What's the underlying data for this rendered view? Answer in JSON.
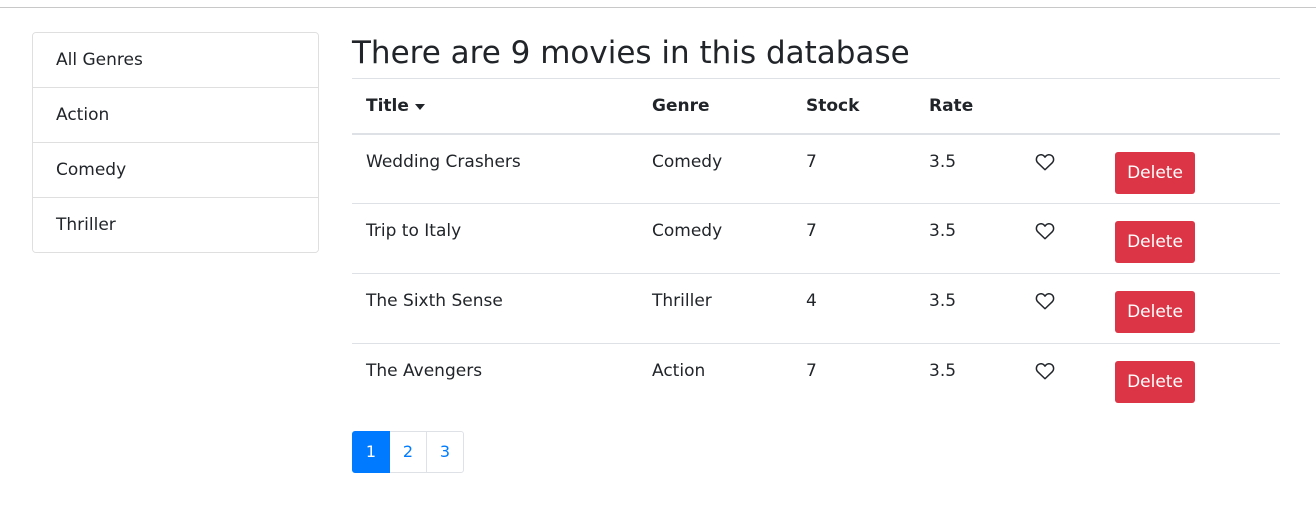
{
  "sidebar": {
    "items": [
      {
        "label": "All Genres"
      },
      {
        "label": "Action"
      },
      {
        "label": "Comedy"
      },
      {
        "label": "Thriller"
      }
    ]
  },
  "main": {
    "title": "There are 9 movies in this database",
    "table": {
      "headers": {
        "title": "Title",
        "genre": "Genre",
        "stock": "Stock",
        "rate": "Rate"
      },
      "sort_icon": "caret-down-icon",
      "rows": [
        {
          "title": "Wedding Crashers",
          "genre": "Comedy",
          "stock": "7",
          "rate": "3.5",
          "like_icon": "heart-outline-icon",
          "delete_label": "Delete"
        },
        {
          "title": "Trip to Italy",
          "genre": "Comedy",
          "stock": "7",
          "rate": "3.5",
          "like_icon": "heart-outline-icon",
          "delete_label": "Delete"
        },
        {
          "title": "The Sixth Sense",
          "genre": "Thriller",
          "stock": "4",
          "rate": "3.5",
          "like_icon": "heart-outline-icon",
          "delete_label": "Delete"
        },
        {
          "title": "The Avengers",
          "genre": "Action",
          "stock": "7",
          "rate": "3.5",
          "like_icon": "heart-outline-icon",
          "delete_label": "Delete"
        }
      ]
    }
  },
  "pagination": {
    "pages": [
      "1",
      "2",
      "3"
    ],
    "active": "1"
  },
  "colors": {
    "danger": "#dc3545",
    "primary": "#007bff",
    "border": "#dee2e6"
  }
}
